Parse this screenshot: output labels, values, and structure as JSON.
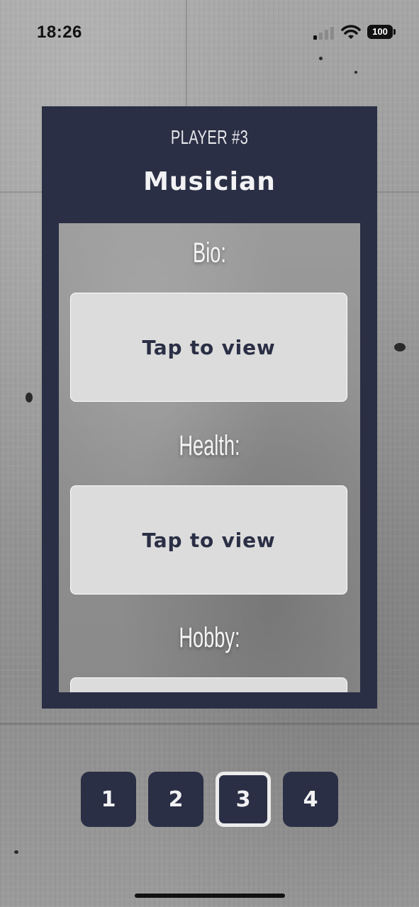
{
  "status_bar": {
    "time": "18:26",
    "battery": "100"
  },
  "card": {
    "player_label": "PLAYER #3",
    "role": "Musician",
    "sections": [
      {
        "label": "Bio:",
        "button_label": "Tap to view"
      },
      {
        "label": "Health:",
        "button_label": "Tap to view"
      },
      {
        "label": "Hobby:",
        "button_label": ""
      }
    ]
  },
  "pager": {
    "pages": [
      "1",
      "2",
      "3",
      "4"
    ],
    "active": "3"
  },
  "colors": {
    "card": "#2a2f45",
    "view_box": "#dcdcdc",
    "text_dark": "#2a2f45",
    "text_light": "#f2f2f4"
  }
}
